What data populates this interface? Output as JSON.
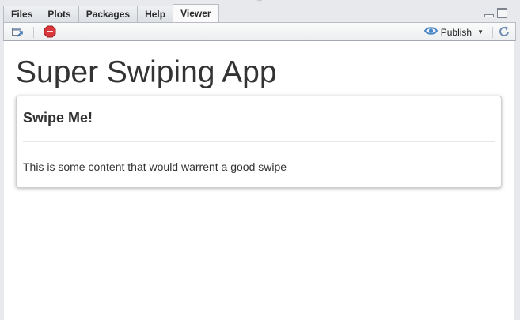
{
  "pane": {
    "tabs": [
      {
        "label": "Files",
        "active": false
      },
      {
        "label": "Plots",
        "active": false
      },
      {
        "label": "Packages",
        "active": false
      },
      {
        "label": "Help",
        "active": false
      },
      {
        "label": "Viewer",
        "active": true
      }
    ]
  },
  "toolbar": {
    "icons": [
      "show-in-window-icon",
      "stop-icon",
      "publish-icon",
      "refresh-icon"
    ],
    "publish_label": "Publish"
  },
  "viewer": {
    "app_title": "Super Swiping App",
    "card": {
      "title": "Swipe Me!",
      "body": "This is some content that would warrent a good swipe"
    }
  },
  "colors": {
    "pane_bg": "#e7e9ec",
    "stop_red": "#d9373b",
    "publish_blue": "#4a86c5",
    "text": "#333333"
  }
}
